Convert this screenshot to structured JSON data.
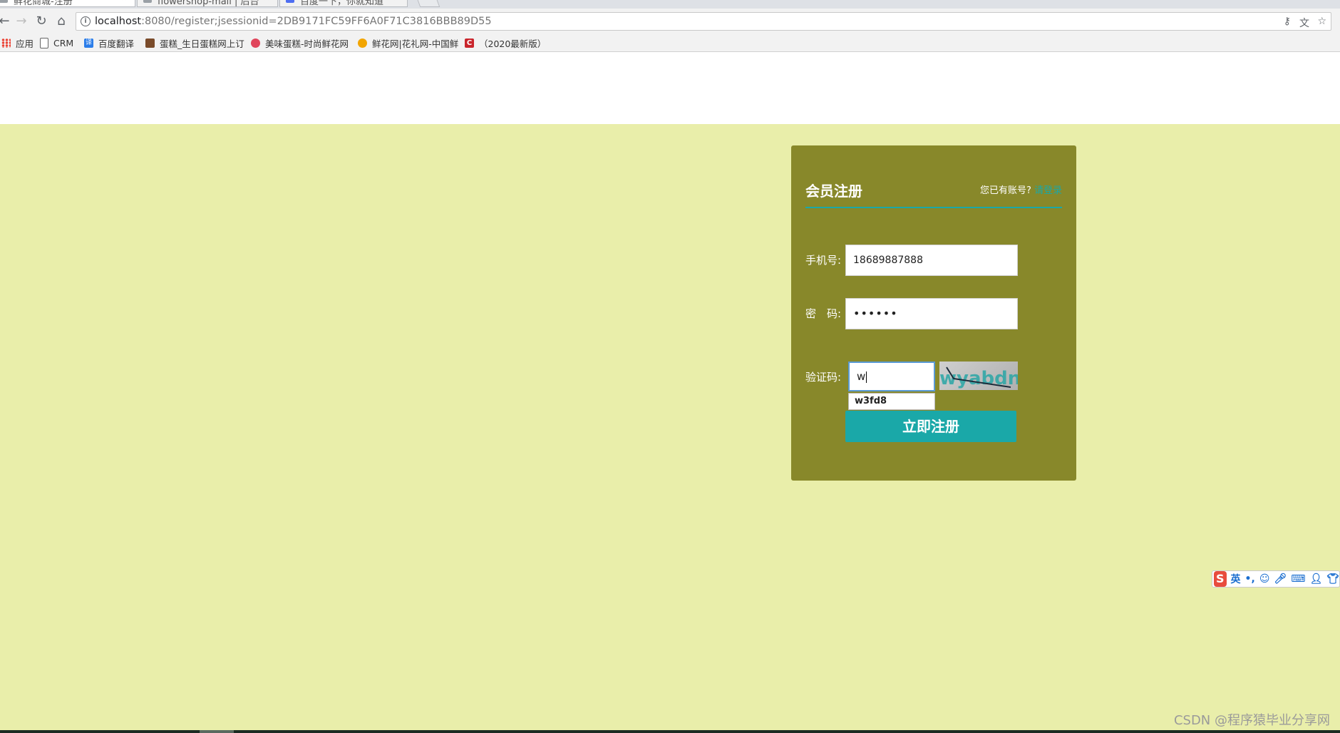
{
  "browser": {
    "tabs": [
      {
        "title": "鲜花商城-注册",
        "active": true
      },
      {
        "title": "flowershop-mall | 后台",
        "active": false
      },
      {
        "title": "百度一下，你就知道",
        "active": false
      }
    ],
    "url_host": "localhost",
    "url_rest": ":8080/register;jsessionid=2DB9171FC59FF6A0F71C3816BBB89D55",
    "bookmarks": [
      {
        "label": "应用",
        "icon": "apps-icon"
      },
      {
        "label": "CRM",
        "icon": "page-icon"
      },
      {
        "label": "百度翻译",
        "icon": "translate-icon"
      },
      {
        "label": "蛋糕_生日蛋糕网上订",
        "icon": "cake-icon"
      },
      {
        "label": "美味蛋糕-时尚鲜花网",
        "icon": "flower-red-icon"
      },
      {
        "label": "鲜花网|花礼网-中国鲜",
        "icon": "flower-yellow-icon"
      },
      {
        "label": "（2020最新版）",
        "icon": "c-logo-icon"
      }
    ]
  },
  "register": {
    "title": "会员注册",
    "has_account_text": "您已有账号?",
    "login_link": "请登录",
    "phone_label": "手机号:",
    "phone_value": "18689887888",
    "password_label": "密　码:",
    "password_value": "••••••",
    "captcha_label": "验证码:",
    "captcha_input_value": "w",
    "captcha_image_text": "wyabdn",
    "autocomplete_suggestion": "w3fd8",
    "submit_label": "立即注册"
  },
  "ime": {
    "mode": "英"
  },
  "watermark": "CSDN @程序猿毕业分享网",
  "colors": {
    "page_bg": "#e9eeaa",
    "panel_bg": "#88882a",
    "accent": "#1aa8a8"
  }
}
